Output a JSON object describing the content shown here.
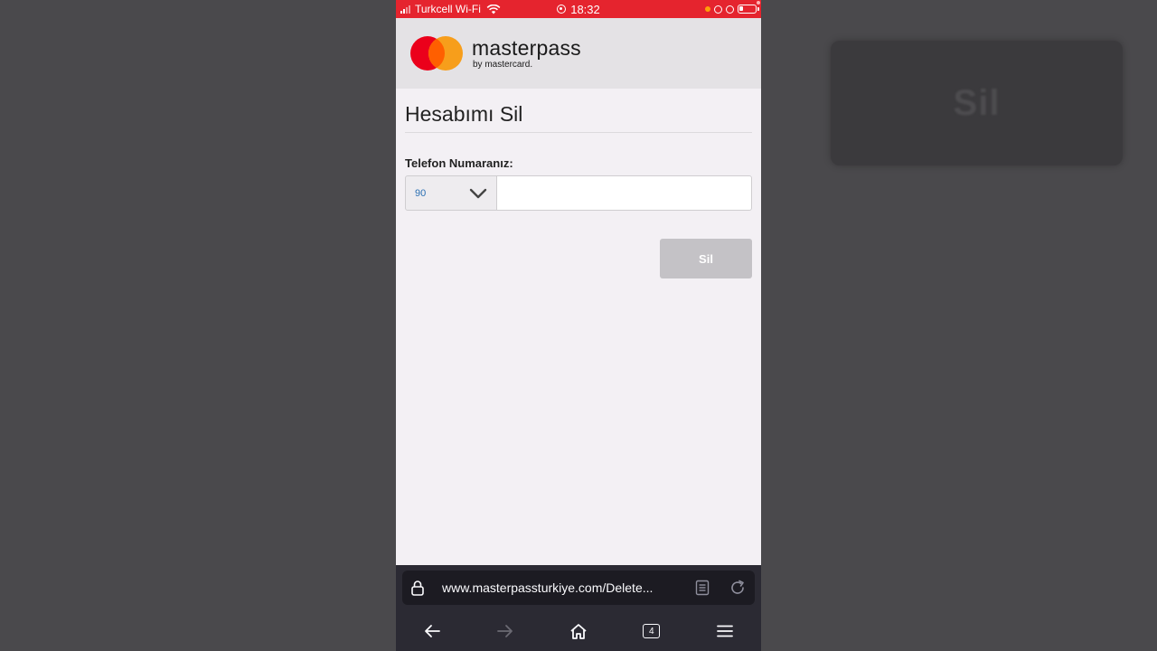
{
  "status_bar": {
    "carrier": "Turkcell Wi-Fi",
    "time": "18:32"
  },
  "header": {
    "brand": "masterpass",
    "sub": "by mastercard."
  },
  "page": {
    "title": "Hesabımı Sil",
    "phone_label": "Telefon Numaranız:",
    "country_code": "90",
    "phone_value": "",
    "delete_label": "Sil"
  },
  "browser": {
    "url": "www.masterpassturkiye.com/Delete...",
    "tab_count": "4"
  },
  "background_card": {
    "label": "Sil"
  },
  "colors": {
    "status_bar": "#e5242e",
    "button_disabled": "#c4c2c6",
    "browser_bar": "#2b2a33"
  }
}
